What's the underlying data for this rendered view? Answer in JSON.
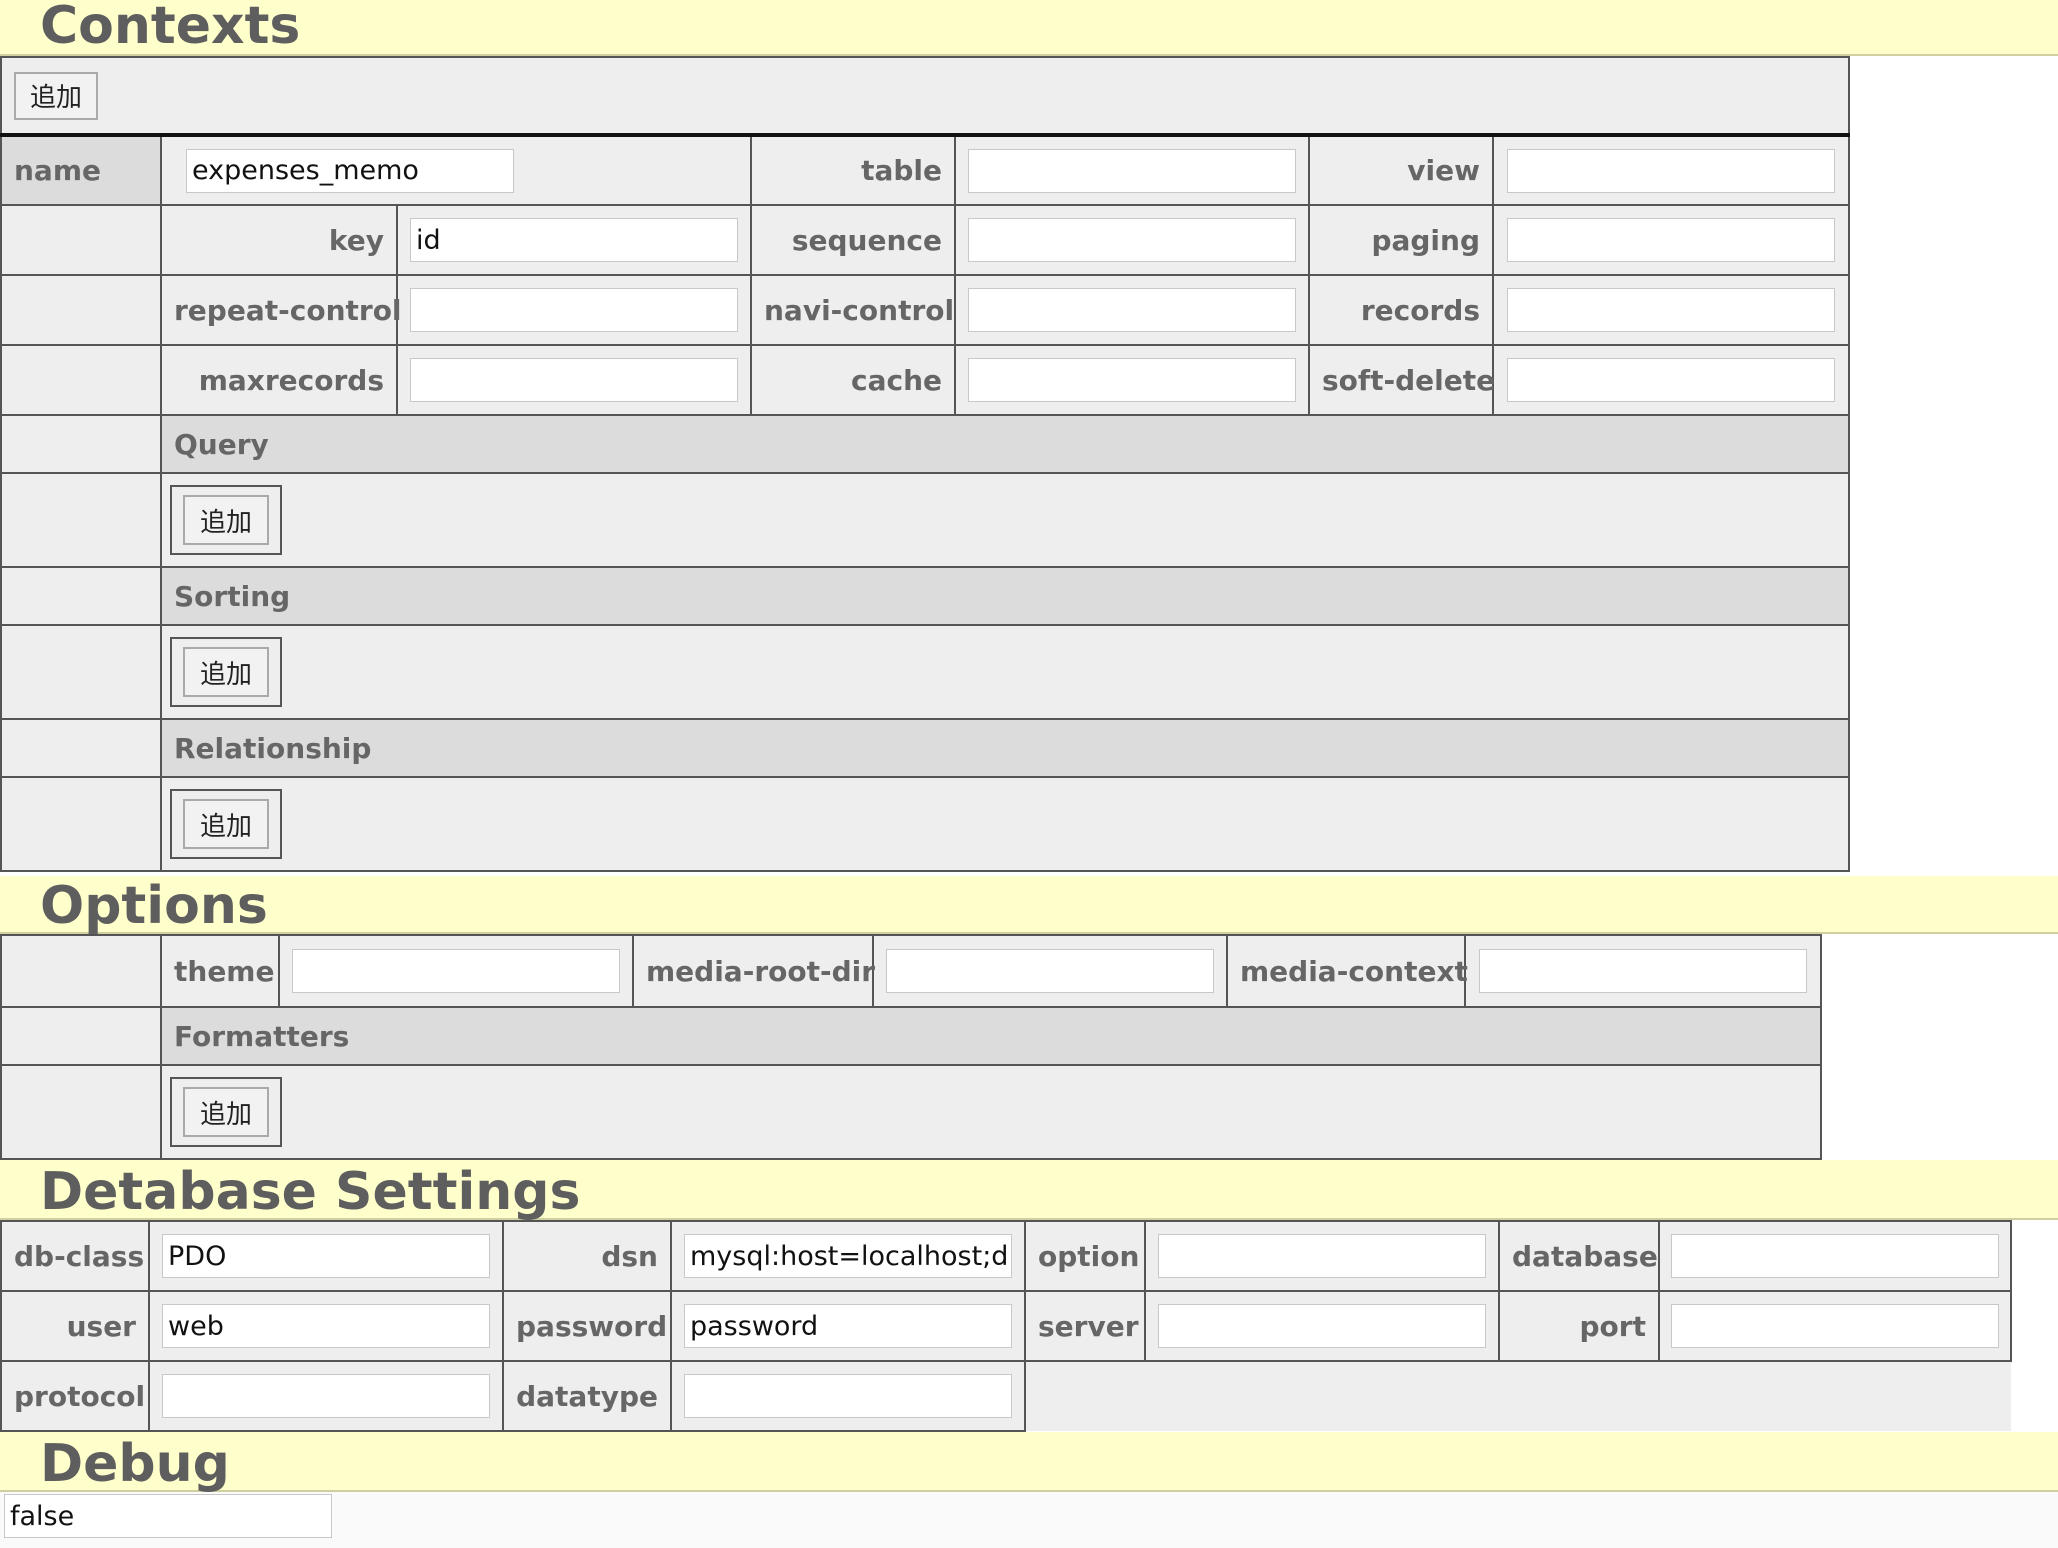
{
  "contexts": {
    "title": "Contexts",
    "add_label": "追加",
    "fields": {
      "name_label": "name",
      "name_value": "expenses_memo",
      "table_label": "table",
      "table_value": "",
      "view_label": "view",
      "view_value": "",
      "key_label": "key",
      "key_value": "id",
      "sequence_label": "sequence",
      "sequence_value": "",
      "paging_label": "paging",
      "paging_value": "",
      "repeat_control_label": "repeat-control",
      "repeat_control_value": "",
      "navi_control_label": "navi-control",
      "navi_control_value": "",
      "records_label": "records",
      "records_value": "",
      "maxrecords_label": "maxrecords",
      "maxrecords_value": "",
      "cache_label": "cache",
      "cache_value": "",
      "soft_delete_label": "soft-delete",
      "soft_delete_value": ""
    },
    "query": {
      "title": "Query",
      "add_label": "追加"
    },
    "sorting": {
      "title": "Sorting",
      "add_label": "追加"
    },
    "relationship": {
      "title": "Relationship",
      "add_label": "追加"
    }
  },
  "options": {
    "title": "Options",
    "theme_label": "theme",
    "theme_value": "",
    "media_root_dir_label": "media-root-dir",
    "media_root_dir_value": "",
    "media_context_label": "media-context",
    "media_context_value": "",
    "formatters": {
      "title": "Formatters",
      "add_label": "追加"
    }
  },
  "database": {
    "title": "Detabase Settings",
    "db_class_label": "db-class",
    "db_class_value": "PDO",
    "dsn_label": "dsn",
    "dsn_value": "mysql:host=localhost;dbname=test",
    "option_label": "option",
    "option_value": "",
    "database_label": "database",
    "database_value": "",
    "user_label": "user",
    "user_value": "web",
    "password_label": "password",
    "password_value": "password",
    "server_label": "server",
    "server_value": "",
    "port_label": "port",
    "port_value": "",
    "protocol_label": "protocol",
    "protocol_value": "",
    "datatype_label": "datatype",
    "datatype_value": ""
  },
  "debug": {
    "title": "Debug",
    "value": "false"
  }
}
